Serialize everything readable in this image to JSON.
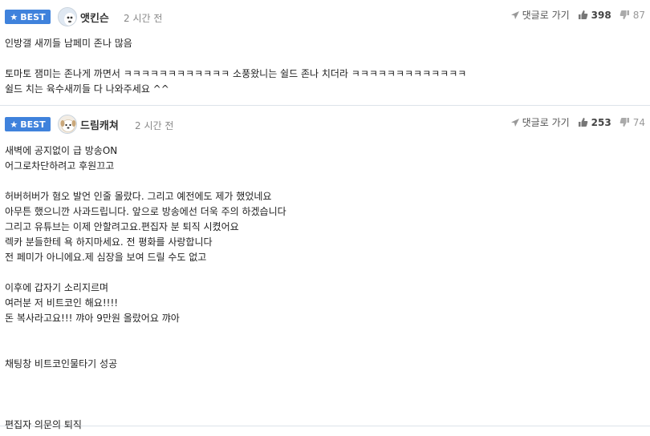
{
  "comments": [
    {
      "badge": "BEST",
      "nickname": "앳킨슨",
      "time": "2 시간 전",
      "reply_label": "댓글로 가기",
      "upvotes": "398",
      "downvotes": "87",
      "lines": [
        "인방갤 새끼들 남페미 존나 많음",
        "",
        "토마토 잼미는 존나게 까면서 ㅋㅋㅋㅋㅋㅋㅋㅋㅋㅋㅋㅋ 소풍왔니는 쉴드 존나 치더라 ㅋㅋㅋㅋㅋㅋㅋㅋㅋㅋㅋㅋㅋ",
        "쉴드 치는 육수새끼들 다 나와주세요 ^^"
      ]
    },
    {
      "badge": "BEST",
      "nickname": "드림캐쳐",
      "time": "2 시간 전",
      "reply_label": "댓글로 가기",
      "upvotes": "253",
      "downvotes": "74",
      "lines": [
        "새벽에 공지없이 급 방송ON",
        "어그로차단하려고 후원끄고",
        "",
        "허버허버가 혐오 발언 인줄 몰랐다. 그리고 예전에도 제가 했었네요",
        "아무튼 했으니깐 사과드립니다. 앞으로 방송에선 더욱 주의 하겠습니다",
        "그리고 유튜브는 이제 안할려고요.편집자 분 퇴직 시켰어요",
        "렉카 분들한테 욕 하지마세요. 전 평화를 사랑합니다",
        "전 페미가 아니에요.제 심장을 보여 드릴 수도 없고",
        "",
        "이후에 갑자기 소리지르며",
        "여러분 저 비트코인 해요!!!!",
        "돈 복사라고요!!! 꺄아 9만원 올랐어요 꺄아",
        "",
        "",
        "채팅창 비트코인물타기 성공",
        "",
        "",
        "",
        "편집자 의문의 퇴직"
      ]
    }
  ],
  "icons": {
    "badge_star": "star-icon",
    "reply": "arrow-icon",
    "upvote": "thumbs-up-icon",
    "downvote": "thumbs-down-icon"
  },
  "colors": {
    "badge_bg": "#3f82dc",
    "divider": "#dde3ea"
  }
}
